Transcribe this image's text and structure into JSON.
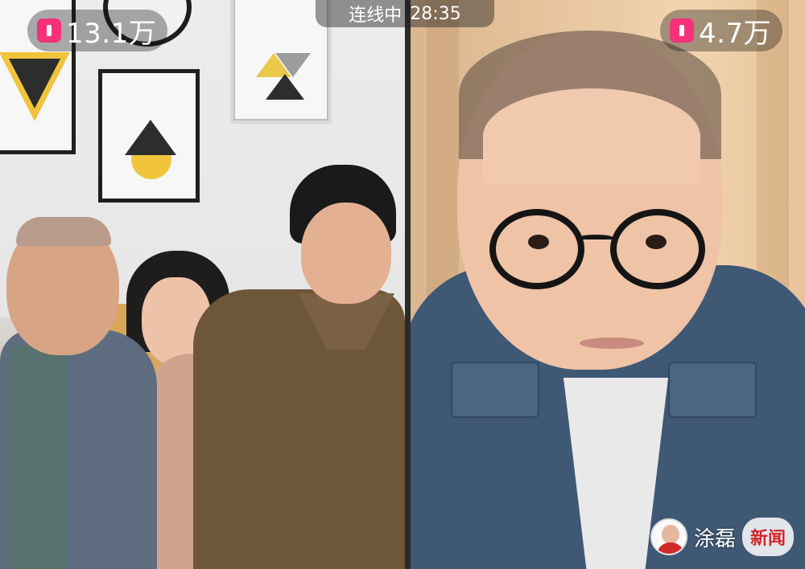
{
  "left_stream": {
    "viewer_count": "13.1万"
  },
  "right_stream": {
    "viewer_count": "4.7万"
  },
  "link_status": {
    "label": "连线中",
    "timer": "28:35"
  },
  "watermark": {
    "name": "涂磊",
    "news_label": "新闻"
  },
  "colors": {
    "badge_pink": "#f5317a",
    "watermark_red": "#d4262b"
  }
}
